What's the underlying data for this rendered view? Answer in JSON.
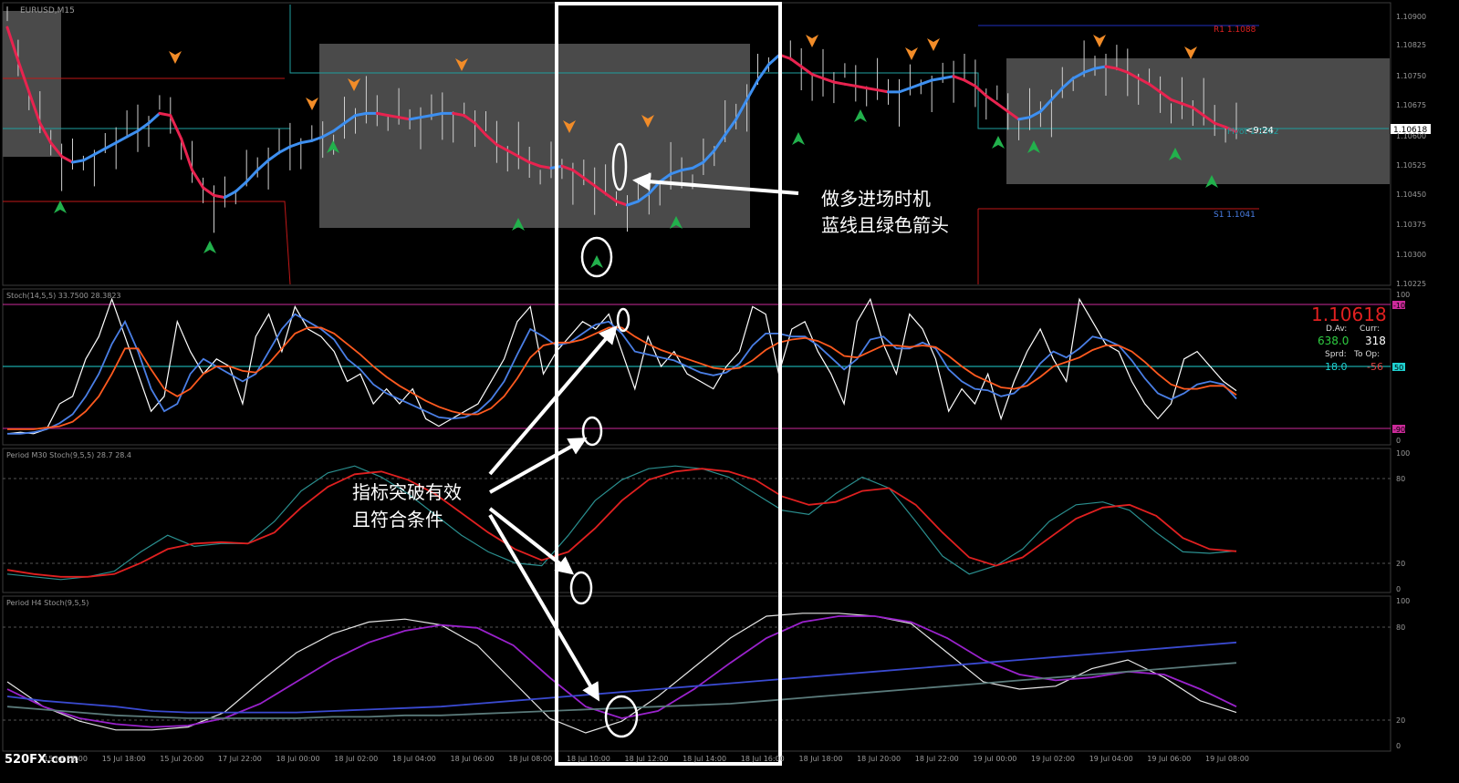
{
  "colors": {
    "background": "#000000",
    "frame": "#3c3c3c",
    "axis_text": "#9a9a9a",
    "zone_fill": "#4a4a4a",
    "ma_up": "#3d8ff0",
    "ma_down": "#e8234f",
    "bar": "#cfcfcf",
    "arrow_buy": "#22b14c",
    "arrow_sell": "#f28c28",
    "pivot_line": "#1f9f9f",
    "r1_line": "#1f2fbf",
    "s1_line": "#c01818",
    "stoch_white": "#ffffff",
    "stoch_blue": "#4a7fe6",
    "stoch_orange": "#ff5a1f",
    "level_magenta": "#cc2a9a",
    "level_cyan": "#1fd0d0",
    "m30_teal": "#2a8f8f",
    "m30_red": "#e02020",
    "h4_white": "#e6e6e6",
    "h4_purple": "#9a22cc",
    "annotation": "#ffffff"
  },
  "main": {
    "symbol": "EURUSD,M15",
    "r1_label": "R1  1.1088",
    "s1_label": "S1  1.1041",
    "pivot_label": "Pivot  1.1062",
    "timer": "<9:24",
    "price_box": "1.10618",
    "price_ticks": [
      "1.10900",
      "1.10825",
      "1.10750",
      "1.10675",
      "1.10600",
      "1.10525",
      "1.10450",
      "1.10375",
      "1.10300",
      "1.10225"
    ],
    "annotation_cn": [
      "做多进场时机",
      "蓝线且绿色箭头"
    ]
  },
  "stoch": {
    "label": "Stoch(14,5,5) 33.7500 28.3823",
    "price_big": "1.10618",
    "stats": {
      "dav_label": "D.Av:",
      "curr_label": "Curr:",
      "dav_value": "638.0",
      "curr_value": "318",
      "sprd_label": "Sprd:",
      "toop_label": "To Op:",
      "sprd_value": "18.0",
      "toop_value": "-56"
    },
    "tick_top": "100",
    "tick_bot": "0",
    "level_hi": "-10",
    "level_mid": "50",
    "level_lo": "-90"
  },
  "m30": {
    "label": "Period M30 Stoch(9,5,5) 28.7 28.4",
    "ticks": [
      "100",
      "80",
      "20",
      "0"
    ]
  },
  "h4": {
    "label": "Period H4 Stoch(9,5,5)",
    "ticks": [
      "100",
      "80",
      "20",
      "0"
    ]
  },
  "annotation_signal": [
    "指标突破有效",
    "且符合条件"
  ],
  "watermark": "520FX.com",
  "time_axis": [
    "15 Jul 16:00",
    "15 Jul 18:00",
    "15 Jul 20:00",
    "17 Jul 22:00",
    "18 Jul 00:00",
    "18 Jul 02:00",
    "18 Jul 04:00",
    "18 Jul 06:00",
    "18 Jul 08:00",
    "18 Jul 10:00",
    "18 Jul 12:00",
    "18 Jul 14:00",
    "18 Jul 16:00",
    "18 Jul 18:00",
    "18 Jul 20:00",
    "18 Jul 22:00",
    "19 Jul 00:00",
    "19 Jul 02:00",
    "19 Jul 04:00",
    "19 Jul 06:00",
    "19 Jul 08:00"
  ],
  "chart_data": [
    {
      "type": "line",
      "panel": "main price (EURUSD M15)",
      "ylim": [
        1.10225,
        1.10925
      ],
      "series": [
        {
          "values": [
            1.10885,
            1.108,
            1.1072,
            1.1064,
            1.1059,
            1.10555,
            1.1054,
            1.10545,
            1.1056,
            1.10575,
            1.1059,
            1.10605,
            1.1062,
            1.1064,
            1.10665,
            1.1066,
            1.106,
            1.1052,
            1.10475,
            1.10455,
            1.1045,
            1.10465,
            1.1049,
            1.1052,
            1.10545,
            1.10565,
            1.1058,
            1.1059,
            1.10595,
            1.10605,
            1.1062,
            1.1064,
            1.1066,
            1.10665,
            1.10665,
            1.1066,
            1.10655,
            1.1065,
            1.10655,
            1.1066,
            1.10665,
            1.10665,
            1.1066,
            1.1064,
            1.1061,
            1.10585,
            1.1057,
            1.10555,
            1.1054,
            1.1053,
            1.10525,
            1.1053,
            1.1052,
            1.105,
            1.1048,
            1.1046,
            1.1044,
            1.1043,
            1.1044,
            1.1046,
            1.1049,
            1.1051,
            1.1052,
            1.10525,
            1.1054,
            1.1057,
            1.1061,
            1.1065,
            1.107,
            1.1075,
            1.1079,
            1.10815,
            1.10805,
            1.10785,
            1.10765,
            1.10755,
            1.10745,
            1.1074,
            1.10735,
            1.1073,
            1.10725,
            1.1072,
            1.1072,
            1.1073,
            1.1074,
            1.1075,
            1.10755,
            1.1076,
            1.1075,
            1.10735,
            1.1071,
            1.1069,
            1.1067,
            1.1065,
            1.10655,
            1.1067,
            1.107,
            1.1073,
            1.10755,
            1.1077,
            1.1078,
            1.10785,
            1.1078,
            1.1077,
            1.10755,
            1.1074,
            1.1072,
            1.107,
            1.1069,
            1.1068,
            1.1066,
            1.1064,
            1.1063,
            1.10618
          ]
        }
      ]
    },
    {
      "type": "line",
      "panel": "Stoch(14,5,5)",
      "ylim": [
        0,
        100
      ],
      "series": [
        {
          "values": [
            5,
            6,
            5,
            8,
            25,
            30,
            55,
            70,
            95,
            70,
            45,
            20,
            30,
            80,
            60,
            45,
            55,
            50,
            25,
            70,
            85,
            60,
            90,
            75,
            70,
            60,
            40,
            45,
            25,
            35,
            25,
            35,
            15,
            10,
            15,
            20,
            25,
            40,
            55,
            80,
            90,
            45,
            60,
            70,
            80,
            75,
            85,
            60,
            35,
            70,
            50,
            60,
            45,
            40,
            35,
            50,
            60,
            90,
            85,
            45,
            75,
            80,
            60,
            45,
            25,
            80,
            95,
            65,
            45,
            85,
            75,
            55,
            20,
            35,
            25,
            45,
            15,
            40,
            60,
            75,
            55,
            40,
            95,
            80,
            65,
            60,
            40,
            25,
            15,
            25,
            55,
            60,
            50,
            40,
            33.75
          ]
        },
        {
          "values": [
            5,
            5,
            6,
            8,
            12,
            18,
            30,
            45,
            65,
            80,
            60,
            35,
            20,
            25,
            45,
            55,
            50,
            45,
            40,
            45,
            60,
            75,
            85,
            80,
            75,
            68,
            55,
            48,
            38,
            32,
            28,
            24,
            20,
            16,
            15,
            16,
            20,
            28,
            40,
            58,
            75,
            70,
            64,
            66,
            72,
            78,
            80,
            72,
            60,
            58,
            56,
            54,
            50,
            46,
            44,
            46,
            52,
            64,
            72,
            72,
            70,
            70,
            64,
            56,
            48,
            55,
            68,
            70,
            62,
            62,
            66,
            62,
            48,
            40,
            35,
            34,
            30,
            32,
            40,
            52,
            60,
            56,
            62,
            70,
            68,
            64,
            54,
            42,
            32,
            28,
            32,
            38,
            40,
            38,
            28.38
          ]
        },
        {
          "values": [
            8,
            8,
            8,
            9,
            10,
            13,
            20,
            30,
            45,
            62,
            62,
            48,
            35,
            30,
            35,
            45,
            50,
            50,
            47,
            46,
            52,
            62,
            72,
            76,
            76,
            72,
            65,
            58,
            50,
            43,
            37,
            32,
            27,
            23,
            20,
            18,
            18,
            22,
            30,
            42,
            56,
            64,
            66,
            66,
            68,
            72,
            76,
            76,
            70,
            65,
            61,
            58,
            55,
            52,
            49,
            48,
            49,
            54,
            61,
            66,
            68,
            69,
            67,
            63,
            57,
            56,
            60,
            64,
            64,
            63,
            64,
            63,
            57,
            50,
            44,
            40,
            36,
            35,
            37,
            43,
            50,
            53,
            56,
            61,
            64,
            64,
            60,
            53,
            45,
            38,
            35,
            35,
            37,
            37,
            31
          ]
        }
      ]
    },
    {
      "type": "line",
      "panel": "Period M30 Stoch(9,5,5)",
      "ylim": [
        0,
        100
      ],
      "series": [
        {
          "values": [
            12,
            10,
            8,
            10,
            14,
            28,
            40,
            32,
            34,
            34,
            50,
            72,
            85,
            90,
            82,
            70,
            55,
            40,
            28,
            20,
            18,
            40,
            65,
            80,
            88,
            90,
            88,
            82,
            70,
            58,
            55,
            70,
            82,
            74,
            50,
            25,
            12,
            18,
            30,
            50,
            62,
            64,
            58,
            42,
            28,
            27,
            28.7
          ]
        },
        {
          "values": [
            15,
            12,
            10,
            10,
            12,
            20,
            30,
            34,
            35,
            34,
            42,
            60,
            75,
            84,
            86,
            80,
            70,
            56,
            42,
            30,
            22,
            28,
            45,
            65,
            80,
            86,
            88,
            86,
            80,
            68,
            62,
            64,
            72,
            74,
            62,
            42,
            24,
            18,
            24,
            38,
            52,
            60,
            62,
            54,
            38,
            30,
            28.4
          ]
        }
      ]
    },
    {
      "type": "line",
      "panel": "Period H4 Stoch(9,5,5)",
      "ylim": [
        0,
        100
      ],
      "series": [
        {
          "values": [
            45,
            28,
            18,
            12,
            12,
            14,
            24,
            45,
            65,
            78,
            86,
            88,
            84,
            70,
            45,
            20,
            10,
            18,
            35,
            55,
            75,
            90,
            92,
            92,
            90,
            85,
            65,
            45,
            40,
            42,
            54,
            60,
            48,
            32,
            24
          ]
        },
        {
          "values": [
            40,
            28,
            20,
            16,
            14,
            15,
            20,
            30,
            45,
            60,
            72,
            80,
            84,
            82,
            70,
            48,
            28,
            20,
            25,
            40,
            58,
            75,
            86,
            90,
            90,
            86,
            75,
            60,
            50,
            46,
            48,
            52,
            50,
            40,
            28
          ]
        },
        {
          "values": [
            35,
            32,
            30,
            28,
            25,
            24,
            24,
            24,
            24,
            25,
            26,
            27,
            28,
            30,
            32,
            34,
            36,
            38,
            40,
            42,
            44,
            46,
            48,
            50,
            52,
            54,
            56,
            58,
            60,
            62,
            64,
            66,
            68,
            70,
            72
          ]
        },
        {
          "values": [
            28,
            26,
            24,
            22,
            21,
            20,
            20,
            20,
            20,
            21,
            21,
            22,
            22,
            23,
            24,
            25,
            26,
            27,
            28,
            29,
            30,
            32,
            34,
            36,
            38,
            40,
            42,
            44,
            46,
            48,
            50,
            52,
            54,
            56,
            58
          ]
        }
      ]
    }
  ]
}
